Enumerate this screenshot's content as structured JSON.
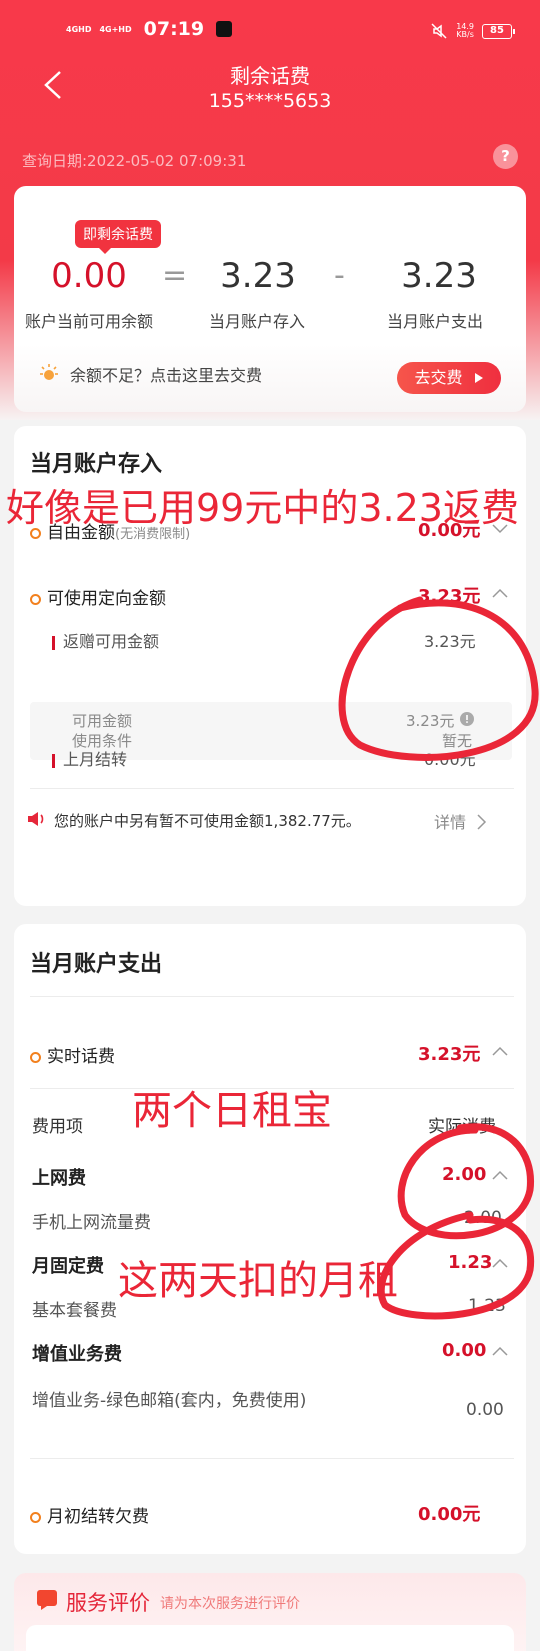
{
  "status": {
    "signal1": "4GHD",
    "signal2": "4G+HD",
    "time": "07:19",
    "net_speed": "14.9",
    "net_unit": "KB/s",
    "battery": "85"
  },
  "header": {
    "title": "剩余话费",
    "phone": "155****5653",
    "query_date": "查询日期:2022-05-02 07:09:31",
    "help": "?"
  },
  "summary": {
    "badge": "即剩余话费",
    "balance": "0.00",
    "balance_label": "账户当前可用余额",
    "eq": "=",
    "deposit": "3.23",
    "deposit_label": "当月账户存入",
    "minus": "-",
    "expense": "3.23",
    "expense_label": "当月账户支出",
    "tip": "余额不足？点击这里去交费",
    "pay_button": "去交费"
  },
  "deposit_section": {
    "title": "当月账户存入",
    "free_amount_label": "自由金额",
    "free_amount_note": "(无消费限制)",
    "free_amount_value": "0.00元",
    "directed_label": "可使用定向金额",
    "directed_value": "3.23元",
    "rebate_label": "返赠可用金额",
    "rebate_value": "3.23元",
    "cond_label1": "可用金额",
    "cond_label2": "使用条件",
    "cond_value1": "3.23元",
    "cond_value2": "暂无",
    "lastmonth_label": "上月结转",
    "lastmonth_value": "0.00元",
    "notice": "您的账户中另有暂不可使用金额1,382.77元。",
    "detail": "详情"
  },
  "expense_section": {
    "title": "当月账户支出",
    "realtime_label": "实时话费",
    "realtime_value": "3.23元",
    "col_item": "费用项",
    "col_actual": "实际消费",
    "internet_label": "上网费",
    "internet_value": "2.00",
    "mobile_data_label": "手机上网流量费",
    "mobile_data_value": "2.00",
    "monthly_label": "月固定费",
    "monthly_value": "1.23",
    "basic_plan_label": "基本套餐费",
    "basic_plan_value": "1.23",
    "vas_label": "增值业务费",
    "vas_value": "0.00",
    "vas_item_label": "增值业务-绿色邮箱(套内，免费使用)",
    "vas_item_value": "0.00",
    "arrears_label": "月初结转欠费",
    "arrears_value": "0.00元"
  },
  "service": {
    "title": "服务评价",
    "subtitle": "请为本次服务进行评价"
  },
  "annotations": {
    "note1": "好像是已用99元中的3.23返费",
    "note2": "两个日租宝",
    "note3": "这两天扣的月租"
  },
  "colors": {
    "brand_red": "#f33a48",
    "amount_red": "#d5112a",
    "ink_red": "#ea2637",
    "ring_orange": "#f2801e"
  }
}
